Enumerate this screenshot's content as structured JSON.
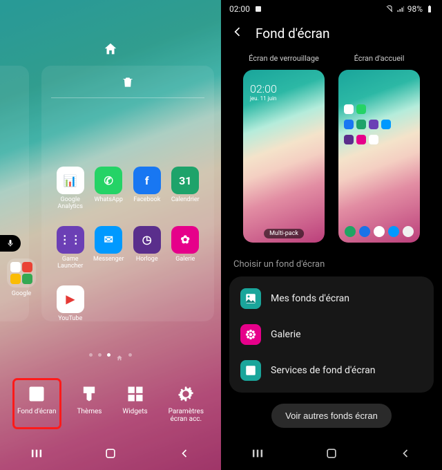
{
  "left": {
    "apps": [
      {
        "label": "Google\nAnalytics",
        "bg": "#ffffff",
        "emoji": "📊"
      },
      {
        "label": "WhatsApp",
        "bg": "#25D366",
        "emoji": "✆"
      },
      {
        "label": "Facebook",
        "bg": "#1877F2",
        "emoji": "f"
      },
      {
        "label": "Calendrier",
        "bg": "#1ea36a",
        "emoji": "31"
      },
      {
        "label": "Game\nLauncher",
        "bg": "#6b3fb5",
        "emoji": "⋮⋮"
      },
      {
        "label": "Messenger",
        "bg": "#0099FF",
        "emoji": "✉"
      },
      {
        "label": "Horloge",
        "bg": "#5a2e8c",
        "emoji": "◷"
      },
      {
        "label": "Galerie",
        "bg": "#e6008a",
        "emoji": "✿"
      },
      {
        "label": "YouTube",
        "bg": "#ffffff",
        "emoji": "▶"
      }
    ],
    "folder_label": "Google",
    "bottom": [
      {
        "label": "Fond d'écran",
        "highlight": true
      },
      {
        "label": "Thèmes",
        "highlight": false
      },
      {
        "label": "Widgets",
        "highlight": false
      },
      {
        "label": "Paramètres\nécran acc.",
        "highlight": false
      }
    ]
  },
  "right": {
    "time": "02:00",
    "battery": "98%",
    "title": "Fond d'écran",
    "lock_caption": "Écran de verrouillage",
    "home_caption": "Écran d'accueil",
    "lock_time": "02:00",
    "lock_date": "jeu. 11 juin",
    "badge": "Multi-pack",
    "section_title": "Choisir un fond d'écran",
    "options": [
      {
        "label": "Mes fonds d'écran",
        "bg": "#1aa59b"
      },
      {
        "label": "Galerie",
        "bg": "#e6008a"
      },
      {
        "label": "Services de fond d'écran",
        "bg": "#1aa59b"
      }
    ],
    "more": "Voir autres fonds écran"
  }
}
